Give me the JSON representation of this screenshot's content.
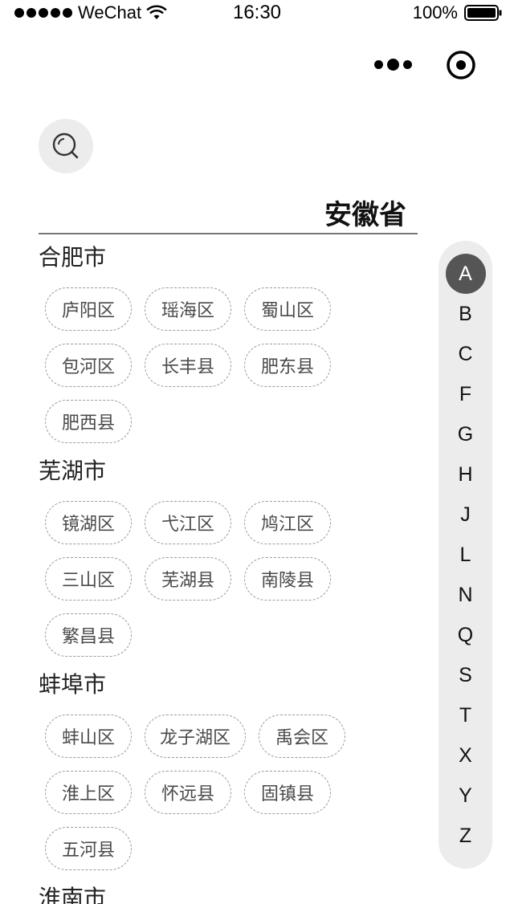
{
  "status_bar": {
    "carrier": "WeChat",
    "time": "16:30",
    "battery": "100%"
  },
  "capsule": {
    "more_icon": "more-dots-icon",
    "close_icon": "target-close-icon"
  },
  "search": {
    "icon": "search-icon"
  },
  "province": "安徽省",
  "cities": [
    {
      "name": "合肥市",
      "districts": [
        "庐阳区",
        "瑶海区",
        "蜀山区",
        "包河区",
        "长丰县",
        "肥东县",
        "肥西县"
      ]
    },
    {
      "name": "芜湖市",
      "districts": [
        "镜湖区",
        "弋江区",
        "鸠江区",
        "三山区",
        "芜湖县",
        "南陵县",
        "繁昌县"
      ]
    },
    {
      "name": "蚌埠市",
      "districts": [
        "蚌山区",
        "龙子湖区",
        "禹会区",
        "淮上区",
        "怀远县",
        "固镇县",
        "五河县"
      ]
    },
    {
      "name": "淮南市",
      "districts": []
    }
  ],
  "alphabet": [
    "A",
    "B",
    "C",
    "F",
    "G",
    "H",
    "J",
    "L",
    "N",
    "Q",
    "S",
    "T",
    "X",
    "Y",
    "Z"
  ],
  "alphabet_active": "A",
  "colors": {
    "chip_border": "#9a9a9a",
    "index_bg": "#ececec",
    "index_active": "#555555"
  }
}
